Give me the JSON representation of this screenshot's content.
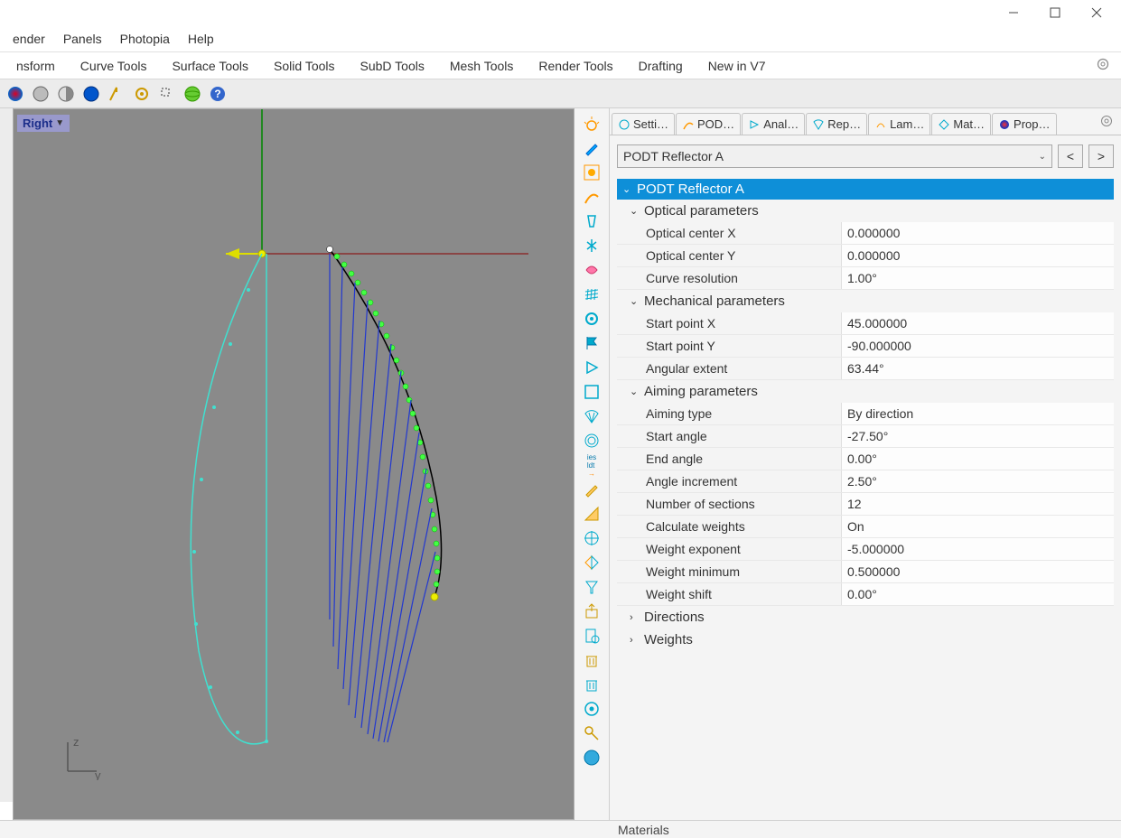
{
  "menubar": [
    "ender",
    "Panels",
    "Photopia",
    "Help"
  ],
  "tabs": [
    "nsform",
    "Curve Tools",
    "Surface Tools",
    "Solid Tools",
    "SubD Tools",
    "Mesh Tools",
    "Render Tools",
    "Drafting",
    "New in V7"
  ],
  "viewport": {
    "label": "Right",
    "axis_v": "z",
    "axis_h": "y"
  },
  "panel_tabs": [
    "Setti…",
    "POD…",
    "Anal…",
    "Rep…",
    "Lam…",
    "Mat…",
    "Prop…"
  ],
  "dropdown": {
    "selected": "PODT Reflector A",
    "prev": "<",
    "next": ">"
  },
  "tree": {
    "root": "PODT Reflector A",
    "groups": [
      {
        "title": "Optical parameters",
        "open": true,
        "rows": [
          {
            "label": "Optical center X",
            "value": "0.000000"
          },
          {
            "label": "Optical center Y",
            "value": "0.000000"
          },
          {
            "label": "Curve resolution",
            "value": "1.00°"
          }
        ]
      },
      {
        "title": "Mechanical parameters",
        "open": true,
        "rows": [
          {
            "label": "Start point X",
            "value": "45.000000"
          },
          {
            "label": "Start point Y",
            "value": "-90.000000"
          },
          {
            "label": "Angular extent",
            "value": "63.44°"
          }
        ]
      },
      {
        "title": "Aiming parameters",
        "open": true,
        "rows": [
          {
            "label": "Aiming type",
            "value": "By direction"
          },
          {
            "label": "Start angle",
            "value": "-27.50°"
          },
          {
            "label": "End angle",
            "value": "0.00°"
          },
          {
            "label": "Angle increment",
            "value": "2.50°"
          },
          {
            "label": "Number of sections",
            "value": "12"
          },
          {
            "label": "Calculate weights",
            "value": "On"
          },
          {
            "label": "Weight exponent",
            "value": "-5.000000"
          },
          {
            "label": "Weight minimum",
            "value": "0.500000"
          },
          {
            "label": "Weight shift",
            "value": "0.00°"
          }
        ]
      },
      {
        "title": "Directions",
        "open": false,
        "rows": []
      },
      {
        "title": "Weights",
        "open": false,
        "rows": []
      }
    ]
  },
  "bottom": "Materials",
  "chart_data": {
    "type": "curve",
    "description": "Reflector profile with aiming rays in Right viewport",
    "optical_center": [
      0,
      0
    ],
    "start_point": [
      45,
      -90
    ],
    "angular_extent_deg": 63.44,
    "aiming": {
      "start_deg": -27.5,
      "end_deg": 0.0,
      "increment_deg": 2.5,
      "sections": 12
    }
  }
}
